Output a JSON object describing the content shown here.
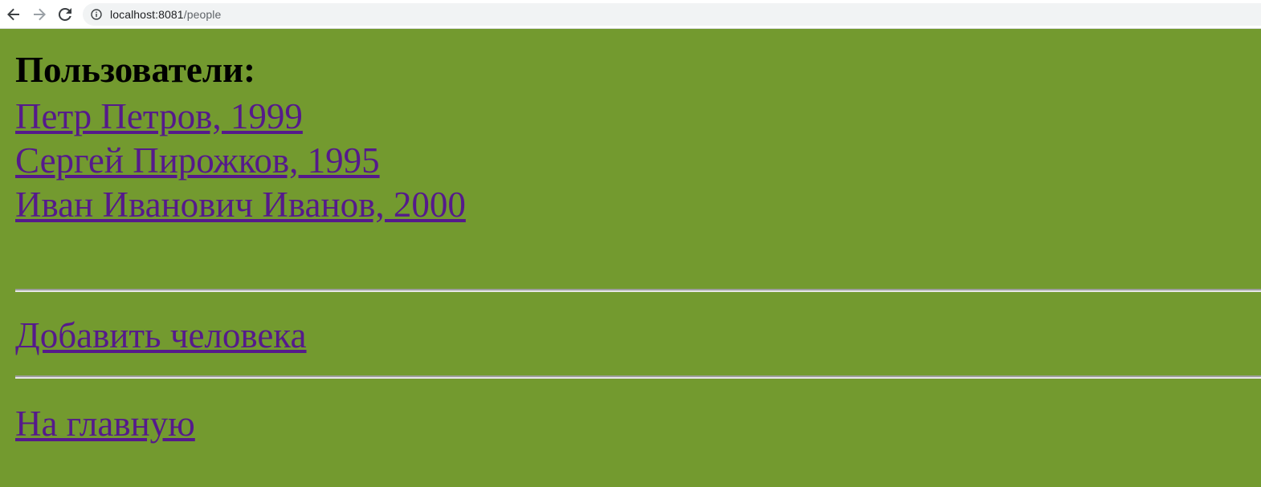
{
  "browser": {
    "url_host": "localhost:8081",
    "url_path": "/people",
    "icons": {
      "back": "arrow-left-icon",
      "forward": "arrow-right-icon",
      "reload": "reload-icon",
      "site_info": "info-icon"
    }
  },
  "page": {
    "background_color": "#739a2f",
    "link_color": "#551a8b",
    "title": "Пользователи:",
    "people": [
      {
        "label": "Петр Петров, 1999"
      },
      {
        "label": "Сергей Пирожков, 1995"
      },
      {
        "label": "Иван Иванович Иванов, 2000"
      }
    ],
    "add_person_link": "Добавить человека",
    "home_link": "На главную"
  }
}
